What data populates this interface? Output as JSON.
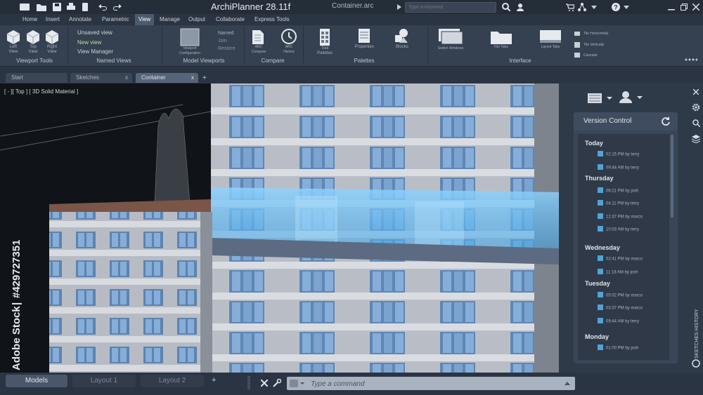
{
  "titlebar": {
    "app_title": "ArchiPlanner 28.11f",
    "file_title": "Container.arc",
    "search_placeholder": "Type a keyword"
  },
  "menu": [
    "Home",
    "Insert",
    "Annotate",
    "Parametric",
    "View",
    "Manage",
    "Output",
    "Collaborate",
    "Express Tools"
  ],
  "menu_active": "View",
  "ribbon": {
    "viewport_tools": {
      "label": "Viewport Tools",
      "items": [
        "Left View",
        "Top View",
        "Right View"
      ]
    },
    "named_views": {
      "label": "Named Views",
      "unsaved": "Unsaved view",
      "new": "New view",
      "manager": "View Manager"
    },
    "model_viewports": {
      "label": "Model Viewports",
      "config": "Viewport Configuration",
      "named": "Named",
      "join": "Join",
      "restore": "Restore"
    },
    "compare": {
      "label": "Compare",
      "arc_compare": "ARC Compare",
      "arc_history": "ARC History"
    },
    "palettes": {
      "label": "Palettes",
      "tool": "Tool Palettes",
      "properties": "Properties",
      "blocks": "Blocks"
    },
    "interface": {
      "label": "Interface",
      "switch": "Switch Windows",
      "file_tabs": "File Tabs",
      "layout_tabs": "Layout Tabs",
      "tile_h": "Tile Horizontally",
      "tile_v": "Tile Vertically",
      "cascade": "Cascade"
    }
  },
  "doc_tabs": [
    "Start",
    "Sketches",
    "Container"
  ],
  "doc_tab_active": "Container",
  "viewport_label": "[ - ][ Top ] [ 3D Solid Material ]",
  "version_control": {
    "title": "Version Control",
    "groups": [
      {
        "day": "Today",
        "entries": [
          "02:15 PM by terry",
          "09:44 AM by terry"
        ]
      },
      {
        "day": "Thursday",
        "entries": [
          "06:21 PM by josh",
          "04:11 PM by terry",
          "12:37 PM by marco",
          "10:03 AM by terry"
        ]
      },
      {
        "day": "Wednesday",
        "entries": [
          "02:41 PM by marco",
          "11:18 AM by josh"
        ]
      },
      {
        "day": "Tuesday",
        "entries": [
          "05:02 PM by marco",
          "03:37 PM by marco",
          "09:44 AM by terry"
        ]
      },
      {
        "day": "Monday",
        "entries": [
          "01:00 PM by josh"
        ]
      }
    ]
  },
  "side_label": "SKETCHES HISTORY",
  "bottom_tabs": [
    "Models",
    "Layout 1",
    "Layout 2"
  ],
  "command_placeholder": "Type a command",
  "watermark": {
    "brand": "Adobe Stock",
    "id": "#429727351"
  },
  "colors": {
    "accent": "#4fa3d6",
    "glass": "#6fc3ff",
    "titlebar": "#252d39",
    "panel": "#3a4658"
  }
}
